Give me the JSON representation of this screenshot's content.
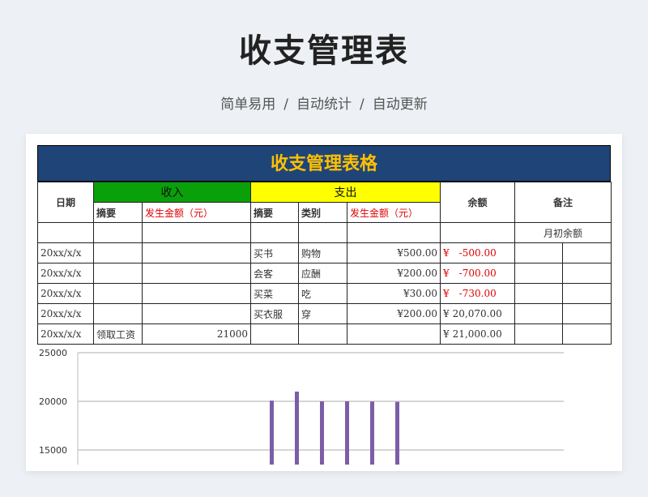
{
  "header": {
    "title": "收支管理表",
    "tags": [
      "简单易用",
      "自动统计",
      "自动更新"
    ],
    "separator": "/"
  },
  "sheet": {
    "title": "收支管理表格",
    "colors": {
      "banner": "#1f4478",
      "banner_text": "#ffc000",
      "income": "#0aa00a",
      "expense": "#ffff00",
      "negative": "#e00000"
    },
    "headers": {
      "date": "日期",
      "income": "收入",
      "expense": "支出",
      "balance": "余额",
      "note": "备注",
      "summary": "摘要",
      "amount": "发生金额（元）",
      "category": "类别"
    },
    "opening_note": "月初余额",
    "rows": [
      {
        "date": "20xx/x/x",
        "in_summary": "",
        "in_amount": "",
        "out_summary": "买书",
        "category": "购物",
        "out_amount": "¥500.00",
        "balance_symbol": "¥",
        "balance": "-500.00",
        "negative": true
      },
      {
        "date": "20xx/x/x",
        "in_summary": "",
        "in_amount": "",
        "out_summary": "会客",
        "category": "应酬",
        "out_amount": "¥200.00",
        "balance_symbol": "¥",
        "balance": "-700.00",
        "negative": true
      },
      {
        "date": "20xx/x/x",
        "in_summary": "",
        "in_amount": "",
        "out_summary": "买菜",
        "category": "吃",
        "out_amount": "¥30.00",
        "balance_symbol": "¥",
        "balance": "-730.00",
        "negative": true
      },
      {
        "date": "20xx/x/x",
        "in_summary": "",
        "in_amount": "",
        "out_summary": "买衣服",
        "category": "穿",
        "out_amount": "¥200.00",
        "balance_symbol": "¥",
        "balance": "20,070.00",
        "negative": false
      },
      {
        "date": "20xx/x/x",
        "in_summary": "领取工资",
        "in_amount": "21000",
        "out_summary": "",
        "category": "",
        "out_amount": "",
        "balance_symbol": "¥",
        "balance": "21,000.00",
        "negative": false
      }
    ]
  },
  "chart_data": {
    "type": "bar",
    "ylim": [
      15000,
      25000
    ],
    "y_ticks": [
      "25000",
      "20000",
      "15000"
    ],
    "values": [
      20070,
      21000,
      20000,
      20000,
      19980,
      19950
    ],
    "color": "#7b5ea7"
  }
}
